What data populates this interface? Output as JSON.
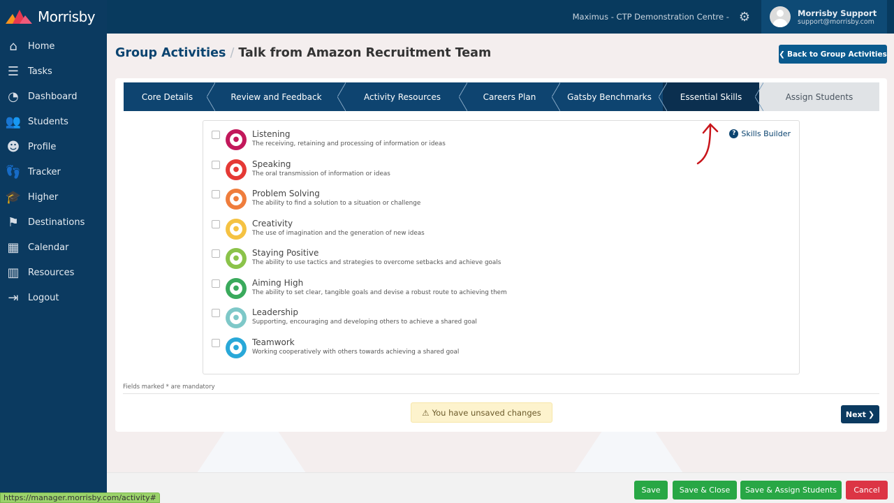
{
  "brand": "Morrisby",
  "sidebar": {
    "items": [
      {
        "label": "Home",
        "icon": "home-icon"
      },
      {
        "label": "Tasks",
        "icon": "tasks-icon"
      },
      {
        "label": "Dashboard",
        "icon": "dashboard-icon"
      },
      {
        "label": "Students",
        "icon": "students-icon"
      },
      {
        "label": "Profile",
        "icon": "profile-icon"
      },
      {
        "label": "Tracker",
        "icon": "tracker-icon"
      },
      {
        "label": "Higher",
        "icon": "graduation-icon"
      },
      {
        "label": "Destinations",
        "icon": "signpost-icon"
      },
      {
        "label": "Calendar",
        "icon": "calendar-icon"
      },
      {
        "label": "Resources",
        "icon": "books-icon"
      },
      {
        "label": "Logout",
        "icon": "logout-icon"
      }
    ]
  },
  "topbar": {
    "centre": "Maximus - CTP Demonstration Centre -",
    "user_name": "Morrisby Support",
    "user_email": "support@morrisby.com"
  },
  "header": {
    "breadcrumb_parent": "Group Activities",
    "separator": "/",
    "title": "Talk from Amazon Recruitment Team",
    "back_label": "Back to Group Activities"
  },
  "tabs": [
    {
      "label": "Core Details"
    },
    {
      "label": "Review and Feedback"
    },
    {
      "label": "Activity Resources"
    },
    {
      "label": "Careers Plan"
    },
    {
      "label": "Gatsby Benchmarks"
    },
    {
      "label": "Essential Skills",
      "active": true
    },
    {
      "label": "Assign Students"
    }
  ],
  "skills_builder_label": "Skills Builder",
  "skills": [
    {
      "name": "Listening",
      "desc": "The receiving, retaining and processing of information or ideas",
      "color": "#c2185b",
      "checked": false
    },
    {
      "name": "Speaking",
      "desc": "The oral transmission of information or ideas",
      "color": "#e53935",
      "checked": false
    },
    {
      "name": "Problem Solving",
      "desc": "The ability to find a solution to a situation or challenge",
      "color": "#ef7d3c",
      "checked": false
    },
    {
      "name": "Creativity",
      "desc": "The use of imagination and the generation of new ideas",
      "color": "#f5c242",
      "checked": false
    },
    {
      "name": "Staying Positive",
      "desc": "The ability to use tactics and strategies to overcome setbacks and achieve goals",
      "color": "#8bc34a",
      "checked": false
    },
    {
      "name": "Aiming High",
      "desc": "The ability to set clear, tangible goals and devise a robust route to achieving them",
      "color": "#3aaa5c",
      "checked": false
    },
    {
      "name": "Leadership",
      "desc": "Supporting, encouraging and developing others to achieve a shared goal",
      "color": "#7ec8c8",
      "checked": false
    },
    {
      "name": "Teamwork",
      "desc": "Working cooperatively with others towards achieving a shared goal",
      "color": "#29a8d8",
      "checked": false
    }
  ],
  "mandatory_note": "Fields marked * are mandatory",
  "unsaved": "You have unsaved changes",
  "next_label": "Next",
  "footer": {
    "save": "Save",
    "save_close": "Save & Close",
    "save_assign": "Save & Assign Students",
    "cancel": "Cancel"
  },
  "status_url": "https://manager.morrisby.com/activity#"
}
